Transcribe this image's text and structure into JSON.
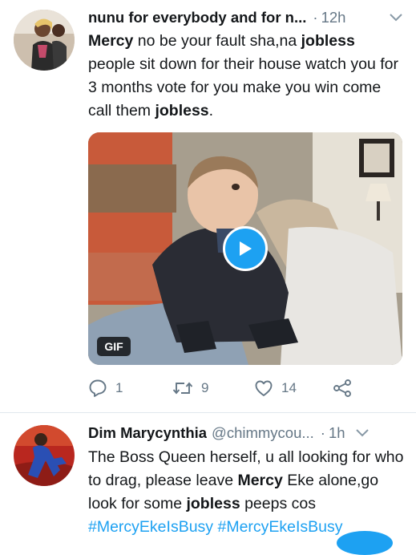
{
  "tweets": [
    {
      "name": "nunu for everybody and for n...",
      "time": "12h",
      "text_parts": [
        "Mercy",
        " no be your fault sha,na ",
        "jobless",
        " people sit down for their house watch you for 3 months vote for you make you win come call them ",
        "jobless",
        "."
      ],
      "media": {
        "badge": "GIF",
        "icon": "play-icon"
      },
      "actions": {
        "replies": "1",
        "retweets": "9",
        "likes": "14"
      }
    },
    {
      "name": "Dim Marycynthia",
      "handle": "@chimmycou...",
      "time": "1h",
      "text_parts": [
        "The Boss Queen herself, u all looking for who to drag, please leave ",
        "Mercy",
        " Eke alone,go look for some ",
        "jobless",
        " peeps cos ",
        "#MercyEkeIsBusy",
        " ",
        "#MercyEkeIsBusy"
      ]
    }
  ],
  "colors": {
    "accent": "#1da1f2",
    "muted": "#657786",
    "text": "#14171a",
    "divider": "#e1e8ed"
  },
  "dot": "·"
}
